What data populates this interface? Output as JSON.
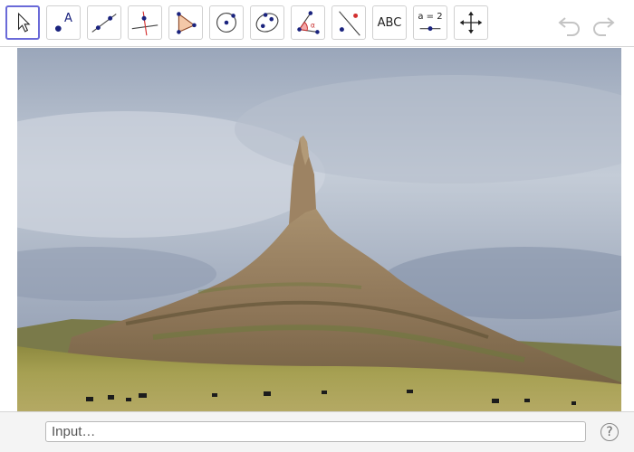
{
  "toolbar": {
    "tools": [
      {
        "id": "move",
        "icon": "pointer-arrow-icon"
      },
      {
        "id": "point",
        "icon": "point-icon",
        "glyph": "A"
      },
      {
        "id": "line",
        "icon": "line-through-two-points-icon"
      },
      {
        "id": "perpendicular",
        "icon": "perpendicular-line-icon"
      },
      {
        "id": "polygon",
        "icon": "polygon-icon"
      },
      {
        "id": "circle",
        "icon": "circle-center-point-icon"
      },
      {
        "id": "ellipse",
        "icon": "ellipse-icon"
      },
      {
        "id": "angle",
        "icon": "angle-icon"
      },
      {
        "id": "reflect",
        "icon": "reflect-about-line-icon"
      },
      {
        "id": "text",
        "icon": "text-icon",
        "label": "ABC"
      },
      {
        "id": "slider",
        "icon": "slider-icon",
        "label": "a = 2"
      },
      {
        "id": "move-graphics",
        "icon": "move-graphics-view-icon"
      }
    ],
    "active_tool": "move",
    "undo_icon": "undo-icon",
    "redo_icon": "redo-icon"
  },
  "input_bar": {
    "placeholder": "Input…",
    "help_label": "?"
  },
  "colors": {
    "active_border": "#6a6ad8",
    "point_blue": "#1a237e",
    "toolbar_border": "#d0d0d0"
  }
}
